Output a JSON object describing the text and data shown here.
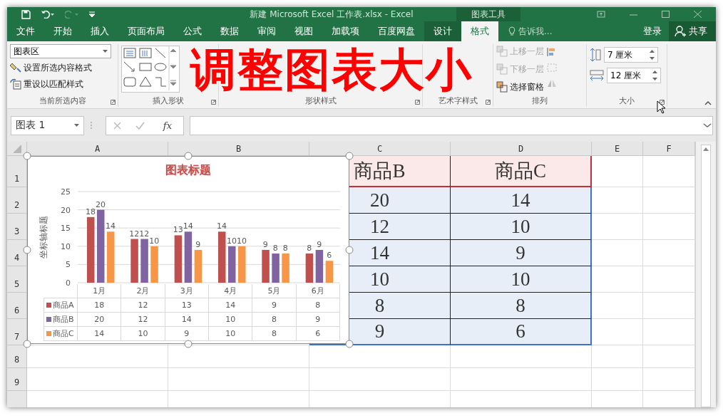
{
  "window": {
    "title": "新建 Microsoft Excel 工作表.xlsx - Excel",
    "context_title": "图表工具"
  },
  "ribbon_tabs": [
    {
      "label": "文件",
      "selected": false,
      "context": false
    },
    {
      "label": "开始",
      "selected": false,
      "context": false
    },
    {
      "label": "插入",
      "selected": false,
      "context": false
    },
    {
      "label": "页面布局",
      "selected": false,
      "context": false
    },
    {
      "label": "公式",
      "selected": false,
      "context": false
    },
    {
      "label": "数据",
      "selected": false,
      "context": false
    },
    {
      "label": "审阅",
      "selected": false,
      "context": false
    },
    {
      "label": "视图",
      "selected": false,
      "context": false
    },
    {
      "label": "加载项",
      "selected": false,
      "context": false
    },
    {
      "label": "百度网盘",
      "selected": false,
      "context": false
    },
    {
      "label": "设计",
      "selected": false,
      "context": true
    },
    {
      "label": "格式",
      "selected": true,
      "context": true
    }
  ],
  "tell_me": {
    "placeholder": "告诉我..."
  },
  "sign_in": "登录",
  "share": "共享",
  "ribbon_groups": [
    {
      "kind": "selection",
      "label": "当前所选内容",
      "dropdown": "图表区",
      "commands": [
        {
          "label": "设置所选内容格式",
          "disabled": false
        },
        {
          "label": "重设以匹配样式",
          "disabled": false
        }
      ]
    },
    {
      "kind": "shapes",
      "label": "插入形状"
    },
    {
      "kind": "shape_styles",
      "label": "形状样式"
    },
    {
      "kind": "wordart",
      "label": "艺术字样式"
    },
    {
      "kind": "arrange",
      "label": "排列",
      "commands": [
        {
          "label": "上移一层",
          "disabled": true
        },
        {
          "label": "下移一层",
          "disabled": true
        },
        {
          "label": "选择窗格",
          "disabled": false
        }
      ]
    },
    {
      "kind": "size",
      "label": "大小",
      "fields": [
        {
          "kind": "height",
          "value": "7 厘米"
        },
        {
          "kind": "width",
          "value": "12 厘米"
        }
      ]
    }
  ],
  "formula_bar": {
    "name_box": "图表 1",
    "function_label": "fx"
  },
  "sheet": {
    "columns": [
      "A",
      "B",
      "C",
      "D",
      "E",
      "F"
    ],
    "rows": [
      "1",
      "2",
      "3",
      "4",
      "5",
      "6",
      "7",
      "8",
      "9"
    ],
    "table": {
      "header": [
        "商品B",
        "商品C"
      ],
      "rows": [
        [
          "20",
          "14"
        ],
        [
          "12",
          "10"
        ],
        [
          "14",
          "9"
        ],
        [
          "10",
          "10"
        ],
        [
          "8",
          "8"
        ],
        [
          "9",
          "6"
        ]
      ]
    }
  },
  "chart": {
    "selected": true,
    "data_table": {
      "rows": [
        [
          "18",
          "12",
          "13",
          "14",
          "9",
          "8"
        ],
        [
          "20",
          "12",
          "14",
          "10",
          "8",
          "9"
        ],
        [
          "14",
          "10",
          "9",
          "10",
          "8",
          "6"
        ]
      ]
    },
    "chart_data": {
      "type": "bar",
      "title": "图表标题",
      "ylabel": "坐标轴标题",
      "categories": [
        "1月",
        "2月",
        "3月",
        "4月",
        "5月",
        "6月"
      ],
      "series": [
        {
          "name": "商品A",
          "color": "#c0504d",
          "values": [
            18,
            12,
            13,
            14,
            9,
            8
          ]
        },
        {
          "name": "商品B",
          "color": "#8064a2",
          "values": [
            20,
            12,
            14,
            10,
            8,
            9
          ]
        },
        {
          "name": "商品C",
          "color": "#f79646",
          "values": [
            14,
            10,
            9,
            10,
            8,
            6
          ]
        }
      ],
      "value_labels": [
        [
          "18",
          "12",
          "13",
          "14",
          "9",
          "8"
        ],
        [
          "20",
          "12",
          "14",
          "10",
          "8",
          "9"
        ],
        [
          "14",
          "10",
          "9",
          "10",
          "8",
          "6"
        ]
      ],
      "ylim": [
        0,
        25
      ],
      "yticks": [
        0,
        5,
        10,
        15,
        20,
        25
      ],
      "grid": true,
      "legend": "left"
    }
  },
  "caption": {
    "text": "调整图表大小"
  }
}
